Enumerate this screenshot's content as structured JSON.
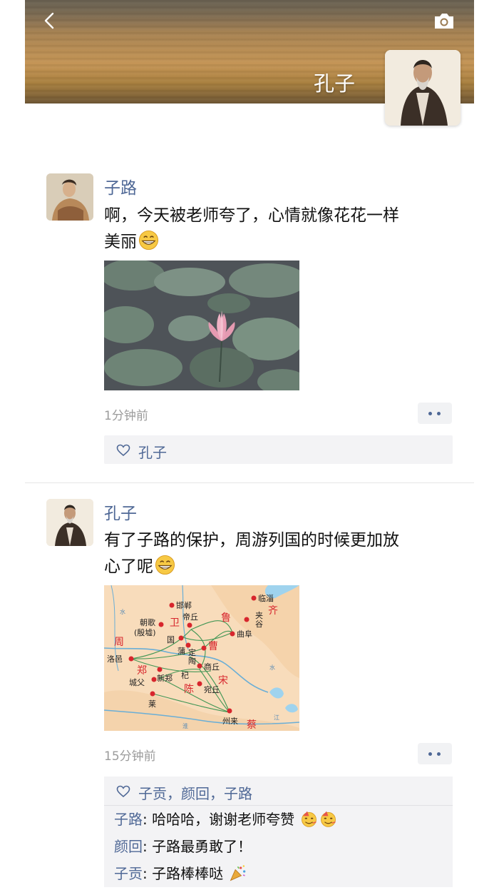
{
  "profile": {
    "name": "孔子"
  },
  "icons": {
    "back": "chevron-left-icon",
    "camera": "camera-icon",
    "like": "heart-outline-icon",
    "more": "more-dots-icon",
    "grin": "grinning-emoji-icon",
    "party": "party-popper-icon"
  },
  "colors": {
    "link_blue": "#4f6896",
    "time_gray": "#9b9b9b",
    "panel_bg": "#f3f3f5"
  },
  "posts": [
    {
      "author": "子路",
      "text_line1": "啊，今天被老师夸了，心情就像花花一样",
      "text_line2": "美丽",
      "time": "1分钟前",
      "likes": "孔子",
      "comments": []
    },
    {
      "author": "孔子",
      "text_line1": "有了子路的保护，周游列国的时候更加放",
      "text_line2": "心了呢",
      "time": "15分钟前",
      "likes": "子贡，颜回，子路",
      "map_labels": {
        "handan": "邯郸",
        "diqiu": "帝丘",
        "linzi": "临淄",
        "wei": "卫",
        "lu": "鲁",
        "qi": "齐",
        "jiagu1": "夹",
        "jiagu2": "谷",
        "chaoge": "朝歌",
        "yinxu": "(殷墟)",
        "qufu": "曲阜",
        "zhou": "周",
        "guo": "国",
        "pu": "蒲",
        "cao": "曹",
        "dingtao1": "定",
        "dingtao2": "陶",
        "luoyi": "洛邑",
        "zheng": "郑",
        "shangqiu": "商丘",
        "xinzheng": "新郑",
        "qi2": "杞",
        "song": "宋",
        "chengfu": "城父",
        "chen": "陈",
        "wanqiu": "宛丘",
        "ye": "莱",
        "zhoulai": "州来",
        "cai": "蔡",
        "jiang": "江",
        "shui1": "水",
        "shui2": "水",
        "huai": "淮"
      },
      "comments": [
        {
          "name": "子路",
          "text": "哈哈哈，谢谢老师夸赞"
        },
        {
          "name": "颜回",
          "text": "子路最勇敢了！"
        },
        {
          "name": "子贡",
          "text": "子路棒棒哒"
        }
      ]
    }
  ]
}
